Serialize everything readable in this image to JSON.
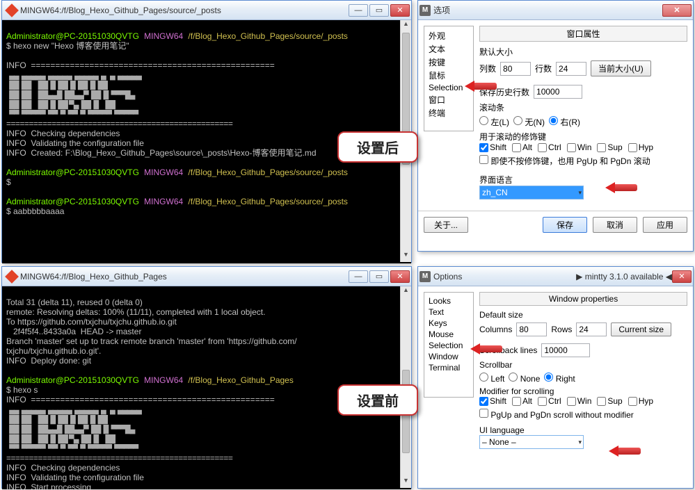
{
  "top_term": {
    "title": "MINGW64:/f/Blog_Hexo_Github_Pages/source/_posts",
    "prompt_user": "Administrator@PC-20151030QVTG",
    "prompt_sys": "MINGW64",
    "prompt_path": "/f/Blog_Hexo_Github_Pages/source/_posts",
    "cmd1": "$ hexo new \"Hexo 博客使用笔记\"",
    "info_hdr": "INFO  ==================================================",
    "line_chk": "INFO  Checking dependencies",
    "line_val": "INFO  Validating the configuration file",
    "line_created": "INFO  Created: F:\\Blog_Hexo_Github_Pages\\source\\_posts\\Hexo-博客使用笔记.md",
    "cmd2": "$ aabbbbbaaaa"
  },
  "bot_term": {
    "title": "MINGW64:/f/Blog_Hexo_Github_Pages",
    "l1": "Total 31 (delta 11), reused 0 (delta 0)",
    "l2": "remote: Resolving deltas: 100% (11/11), completed with 1 local object.",
    "l3": "To https://github.com/txjchu/txjchu.github.io.git",
    "l4": "   2f4f5f4..8433a0a  HEAD -> master",
    "l5": "Branch 'master' set up to track remote branch 'master' from 'https://github.com/",
    "l5b": "txjchu/txjchu.github.io.git'.",
    "l6": "INFO  Deploy done: git",
    "prompt_user": "Administrator@PC-20151030QVTG",
    "prompt_sys": "MINGW64",
    "prompt_path": "/f/Blog_Hexo_Github_Pages",
    "cmd": "$ hexo s",
    "info_hdr": "INFO  ==================================================",
    "line_chk": "INFO  Checking dependencies",
    "line_val": "INFO  Validating the configuration file",
    "line_start": "INFO  Start processing"
  },
  "dlg_cn": {
    "title": "选项",
    "sidebar": [
      "外观",
      "文本",
      "按键",
      "鼠标",
      "Selection",
      "窗口",
      "终端"
    ],
    "group1": "窗口属性",
    "default_size": "默认大小",
    "cols_label": "列数",
    "cols_val": "80",
    "rows_label": "行数",
    "rows_val": "24",
    "cur_size": "当前大小(U)",
    "scrollback_label": "保存历史行数",
    "scrollback_val": "10000",
    "scrollbar_label": "滚动条",
    "r_left": "左(L)",
    "r_none": "无(N)",
    "r_right": "右(R)",
    "mod_label": "用于滚动的修饰键",
    "m_shift": "Shift",
    "m_alt": "Alt",
    "m_ctrl": "Ctrl",
    "m_win": "Win",
    "m_sup": "Sup",
    "m_hyp": "Hyp",
    "pgup_label": "即使不按修饰键，也用 PgUp 和 PgDn 滚动",
    "lang_label": "界面语言",
    "lang_val": "zh_CN",
    "about": "关于...",
    "save": "保存",
    "cancel": "取消",
    "apply": "应用"
  },
  "dlg_en": {
    "title": "Options",
    "avail": "▶  mintty 3.1.0 available  ◀",
    "sidebar": [
      "Looks",
      "Text",
      "Keys",
      "Mouse",
      "Selection",
      "Window",
      "Terminal"
    ],
    "group1": "Window properties",
    "default_size": "Default size",
    "cols_label": "Columns",
    "cols_val": "80",
    "rows_label": "Rows",
    "rows_val": "24",
    "cur_size": "Current size",
    "scrollback_label": "Scrollback lines",
    "scrollback_val": "10000",
    "scrollbar_label": "Scrollbar",
    "r_left": "Left",
    "r_none": "None",
    "r_right": "Right",
    "mod_label": "Modifier for scrolling",
    "m_shift": "Shift",
    "m_alt": "Alt",
    "m_ctrl": "Ctrl",
    "m_win": "Win",
    "m_sup": "Sup",
    "m_hyp": "Hyp",
    "pgup_label": "PgUp and PgDn scroll without modifier",
    "lang_label": "UI language",
    "lang_val": "– None –"
  },
  "callout_after": "设置后",
  "callout_before": "设置前"
}
